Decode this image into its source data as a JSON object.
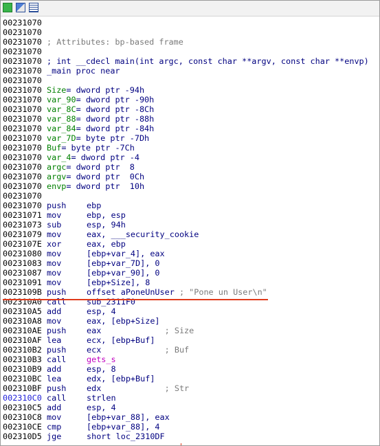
{
  "toolbar": {
    "icons": [
      "graph-view-icon",
      "proximity-view-icon",
      "text-view-icon"
    ]
  },
  "colors": {
    "address": "#000000",
    "address_highlight": "#2020d8",
    "mnemonic": "#000080",
    "comment": "#7a7a7a",
    "variable": "#008000",
    "function": "#c000c0",
    "marker": "#e03a1a"
  },
  "lines": [
    {
      "addr": "00231070",
      "text": ""
    },
    {
      "addr": "00231070",
      "text": ""
    },
    {
      "addr": "00231070",
      "comment": "; Attributes: bp-based frame"
    },
    {
      "addr": "00231070",
      "text": ""
    },
    {
      "addr": "00231070",
      "decl": "; int __cdecl main(int argc, const char **argv, const char **envp)"
    },
    {
      "addr": "00231070",
      "proc": "_main proc near"
    },
    {
      "addr": "00231070",
      "text": ""
    },
    {
      "addr": "00231070",
      "var": "Size",
      "def": "= dword ptr -94h"
    },
    {
      "addr": "00231070",
      "var": "var_90",
      "def": "= dword ptr -90h"
    },
    {
      "addr": "00231070",
      "var": "var_8C",
      "def": "= dword ptr -8Ch"
    },
    {
      "addr": "00231070",
      "var": "var_88",
      "def": "= dword ptr -88h"
    },
    {
      "addr": "00231070",
      "var": "var_84",
      "def": "= dword ptr -84h"
    },
    {
      "addr": "00231070",
      "var": "var_7D",
      "def": "= byte ptr -7Dh"
    },
    {
      "addr": "00231070",
      "var": "Buf",
      "def": "= byte ptr -7Ch"
    },
    {
      "addr": "00231070",
      "var": "var_4",
      "def": "= dword ptr -4"
    },
    {
      "addr": "00231070",
      "var": "argc",
      "def": "= dword ptr  8"
    },
    {
      "addr": "00231070",
      "var": "argv",
      "def": "= dword ptr  0Ch"
    },
    {
      "addr": "00231070",
      "var": "envp",
      "def": "= dword ptr  10h"
    },
    {
      "addr": "00231070",
      "text": ""
    },
    {
      "addr": "00231070",
      "mn": "push",
      "op": "ebp"
    },
    {
      "addr": "00231071",
      "mn": "mov",
      "op": "ebp, esp"
    },
    {
      "addr": "00231073",
      "mn": "sub",
      "op": "esp, 94h"
    },
    {
      "addr": "00231079",
      "mn": "mov",
      "op": "eax, ___security_cookie"
    },
    {
      "addr": "0023107E",
      "mn": "xor",
      "op": "eax, ebp"
    },
    {
      "addr": "00231080",
      "mn": "mov",
      "op": "[ebp+var_4], eax"
    },
    {
      "addr": "00231083",
      "mn": "mov",
      "op": "[ebp+var_7D], 0"
    },
    {
      "addr": "00231087",
      "mn": "mov",
      "op": "[ebp+var_90], 0"
    },
    {
      "addr": "00231091",
      "mn": "mov",
      "op": "[ebp+Size], 8"
    },
    {
      "addr": "0023109B",
      "mn": "push",
      "op": "offset aPoneUnUser",
      "cmt": " ; \"Pone un User\\n\""
    },
    {
      "addr": "002310A0",
      "mn": "call",
      "op": "sub_2311F0"
    },
    {
      "addr": "002310A5",
      "mn": "add",
      "op": "esp, 4"
    },
    {
      "addr": "002310A8",
      "mn": "mov",
      "op": "eax, [ebp+Size]"
    },
    {
      "addr": "002310AE",
      "mn": "push",
      "op": "eax",
      "cmt": "             ; Size"
    },
    {
      "addr": "002310AF",
      "mn": "lea",
      "op": "ecx, [ebp+Buf]"
    },
    {
      "addr": "002310B2",
      "mn": "push",
      "op": "ecx",
      "cmt": "             ; Buf"
    },
    {
      "addr": "002310B3",
      "mn": "call",
      "op": "gets_s",
      "fn": true
    },
    {
      "addr": "002310B9",
      "mn": "add",
      "op": "esp, 8"
    },
    {
      "addr": "002310BC",
      "mn": "lea",
      "op": "edx, [ebp+Buf]"
    },
    {
      "addr": "002310BF",
      "mn": "push",
      "op": "edx",
      "cmt": "             ; Str"
    },
    {
      "addr": "002310C0",
      "mn": "call",
      "op": "strlen",
      "hl": true
    },
    {
      "addr": "002310C5",
      "mn": "add",
      "op": "esp, 4"
    },
    {
      "addr": "002310C8",
      "mn": "mov",
      "op": "[ebp+var_88], eax"
    },
    {
      "addr": "002310CE",
      "mn": "cmp",
      "op": "[ebp+var_88], 4"
    },
    {
      "addr": "002310D5",
      "mn": "jge",
      "op": "short loc_2310DF"
    }
  ]
}
